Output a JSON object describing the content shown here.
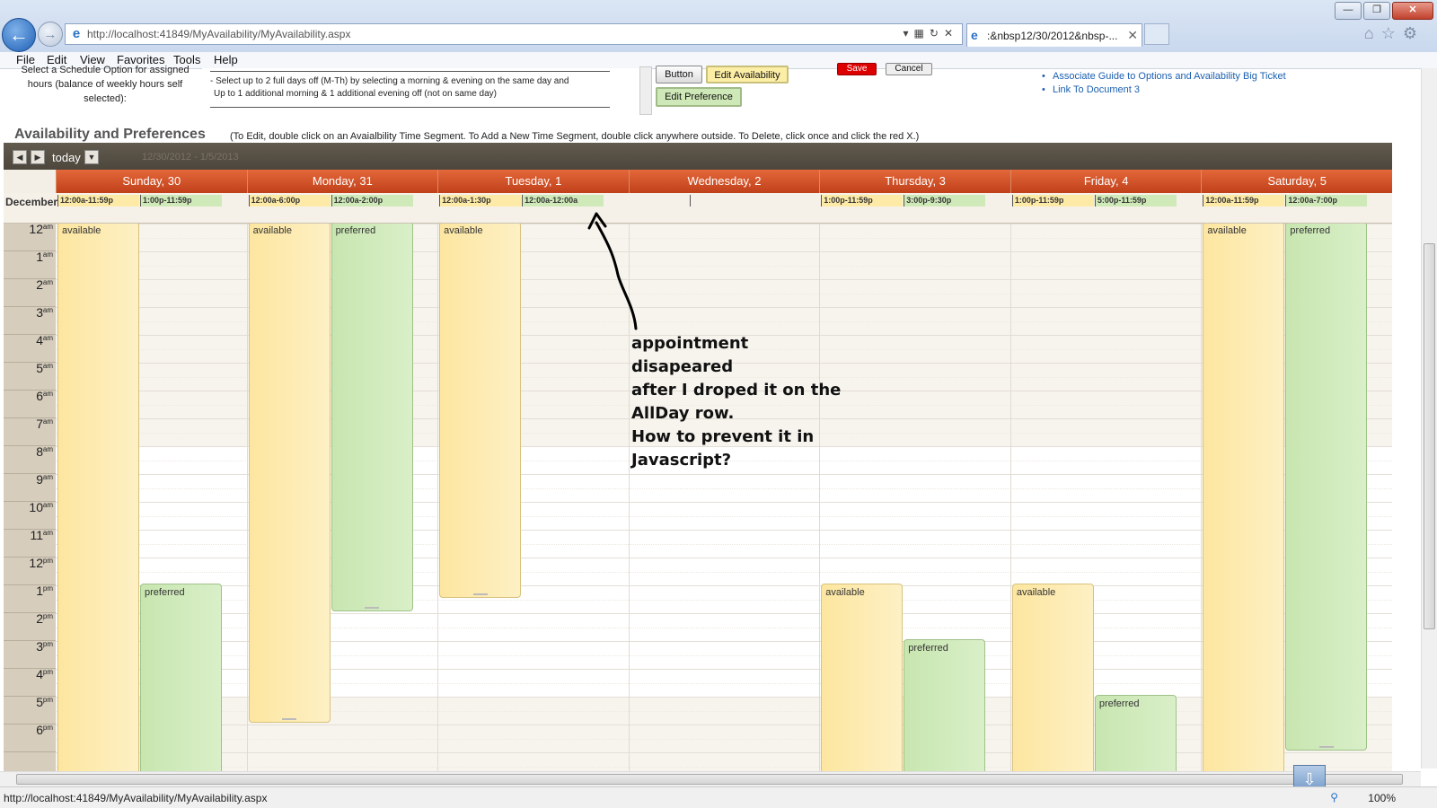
{
  "browser": {
    "url": "http://localhost:41849/MyAvailability/MyAvailability.aspx",
    "tab_title": ":&nbsp12/30/2012&nbsp-...",
    "status_url": "http://localhost:41849/MyAvailability/MyAvailability.aspx",
    "zoom": "100%",
    "menu": [
      "File",
      "Edit",
      "View",
      "Favorites",
      "Tools",
      "Help"
    ]
  },
  "form": {
    "schedule_label": "Select a Schedule Option for assigned hours (balance of weekly hours self selected):",
    "schedule_text_1": "- Select up to 2 full days off (M-Th) by selecting a morning & evening on the same day and",
    "schedule_text_2": "Up to 1 additional morning & 1 additional evening off (not on same day)",
    "btn_button": "Button",
    "btn_edit_availability": "Edit Availability",
    "btn_edit_preference": "Edit Preference",
    "btn_save": "Save",
    "btn_cancel": "Cancel",
    "links": [
      "Associate Guide to Options and Availability Big Ticket",
      "Link To Document 3"
    ]
  },
  "calendar": {
    "title": "Availability and Preferences",
    "help": "(To Edit, double click on an Avaialbility Time Segment. To Add a New Time Segment, double click anywhere outside. To Delete, click once and click the red X.)",
    "today_label": "today",
    "range_label": "12/30/2012 - 1/5/2013",
    "month_label": "December",
    "days": [
      "Sunday, 30",
      "Monday, 31",
      "Tuesday, 1",
      "Wednesday, 2",
      "Thursday, 3",
      "Friday, 4",
      "Saturday, 5"
    ],
    "allday": [
      {
        "day": 0,
        "slot": 0,
        "text": "12:00a-11:59p",
        "type": "available"
      },
      {
        "day": 0,
        "slot": 1,
        "text": "1:00p-11:59p",
        "type": "preferred"
      },
      {
        "day": 1,
        "slot": 0,
        "text": "12:00a-6:00p",
        "type": "available"
      },
      {
        "day": 1,
        "slot": 1,
        "text": "12:00a-2:00p",
        "type": "preferred"
      },
      {
        "day": 2,
        "slot": 0,
        "text": "12:00a-1:30p",
        "type": "available"
      },
      {
        "day": 2,
        "slot": 1,
        "text": "12:00a-12:00a",
        "type": "preferred"
      },
      {
        "day": 4,
        "slot": 0,
        "text": "1:00p-11:59p",
        "type": "available"
      },
      {
        "day": 4,
        "slot": 1,
        "text": "3:00p-9:30p",
        "type": "preferred"
      },
      {
        "day": 5,
        "slot": 0,
        "text": "1:00p-11:59p",
        "type": "available"
      },
      {
        "day": 5,
        "slot": 1,
        "text": "5:00p-11:59p",
        "type": "preferred"
      },
      {
        "day": 6,
        "slot": 0,
        "text": "12:00a-11:59p",
        "type": "available"
      },
      {
        "day": 6,
        "slot": 1,
        "text": "12:00a-7:00p",
        "type": "preferred"
      }
    ],
    "hours": [
      {
        "n": "12",
        "ap": "am"
      },
      {
        "n": "1",
        "ap": "am"
      },
      {
        "n": "2",
        "ap": "am"
      },
      {
        "n": "3",
        "ap": "am"
      },
      {
        "n": "4",
        "ap": "am"
      },
      {
        "n": "5",
        "ap": "am"
      },
      {
        "n": "6",
        "ap": "am"
      },
      {
        "n": "7",
        "ap": "am"
      },
      {
        "n": "8",
        "ap": "am"
      },
      {
        "n": "9",
        "ap": "am"
      },
      {
        "n": "10",
        "ap": "am"
      },
      {
        "n": "11",
        "ap": "am"
      },
      {
        "n": "12",
        "ap": "pm"
      },
      {
        "n": "1",
        "ap": "pm"
      },
      {
        "n": "2",
        "ap": "pm"
      },
      {
        "n": "3",
        "ap": "pm"
      },
      {
        "n": "4",
        "ap": "pm"
      },
      {
        "n": "5",
        "ap": "pm"
      },
      {
        "n": "6",
        "ap": "pm"
      }
    ],
    "events": [
      {
        "day": 0,
        "slot": 0,
        "start": 0,
        "end": 24,
        "label": "available",
        "type": "available"
      },
      {
        "day": 0,
        "slot": 1,
        "start": 13,
        "end": 24,
        "label": "preferred",
        "type": "preferred"
      },
      {
        "day": 1,
        "slot": 0,
        "start": 0,
        "end": 18,
        "label": "available",
        "type": "available"
      },
      {
        "day": 1,
        "slot": 1,
        "start": 0,
        "end": 14,
        "label": "preferred",
        "type": "preferred"
      },
      {
        "day": 2,
        "slot": 0,
        "start": 0,
        "end": 13.5,
        "label": "available",
        "type": "available"
      },
      {
        "day": 4,
        "slot": 0,
        "start": 13,
        "end": 24,
        "label": "available",
        "type": "available"
      },
      {
        "day": 4,
        "slot": 1,
        "start": 15,
        "end": 21.5,
        "label": "preferred",
        "type": "preferred"
      },
      {
        "day": 5,
        "slot": 0,
        "start": 13,
        "end": 24,
        "label": "available",
        "type": "available"
      },
      {
        "day": 5,
        "slot": 1,
        "start": 17,
        "end": 24,
        "label": "preferred",
        "type": "preferred"
      },
      {
        "day": 6,
        "slot": 0,
        "start": 0,
        "end": 24,
        "label": "available",
        "type": "available"
      },
      {
        "day": 6,
        "slot": 1,
        "start": 0,
        "end": 19,
        "label": "preferred",
        "type": "preferred"
      }
    ]
  },
  "annotation": {
    "lines": [
      "appointment disapeared",
      "after I droped it on the",
      "AllDay row.",
      "How to prevent it in",
      "Javascript?"
    ]
  },
  "colors": {
    "available": "#fde6a0",
    "preferred": "#c8e6b0",
    "header": "#d2502a",
    "toolbar": "#554e43"
  }
}
